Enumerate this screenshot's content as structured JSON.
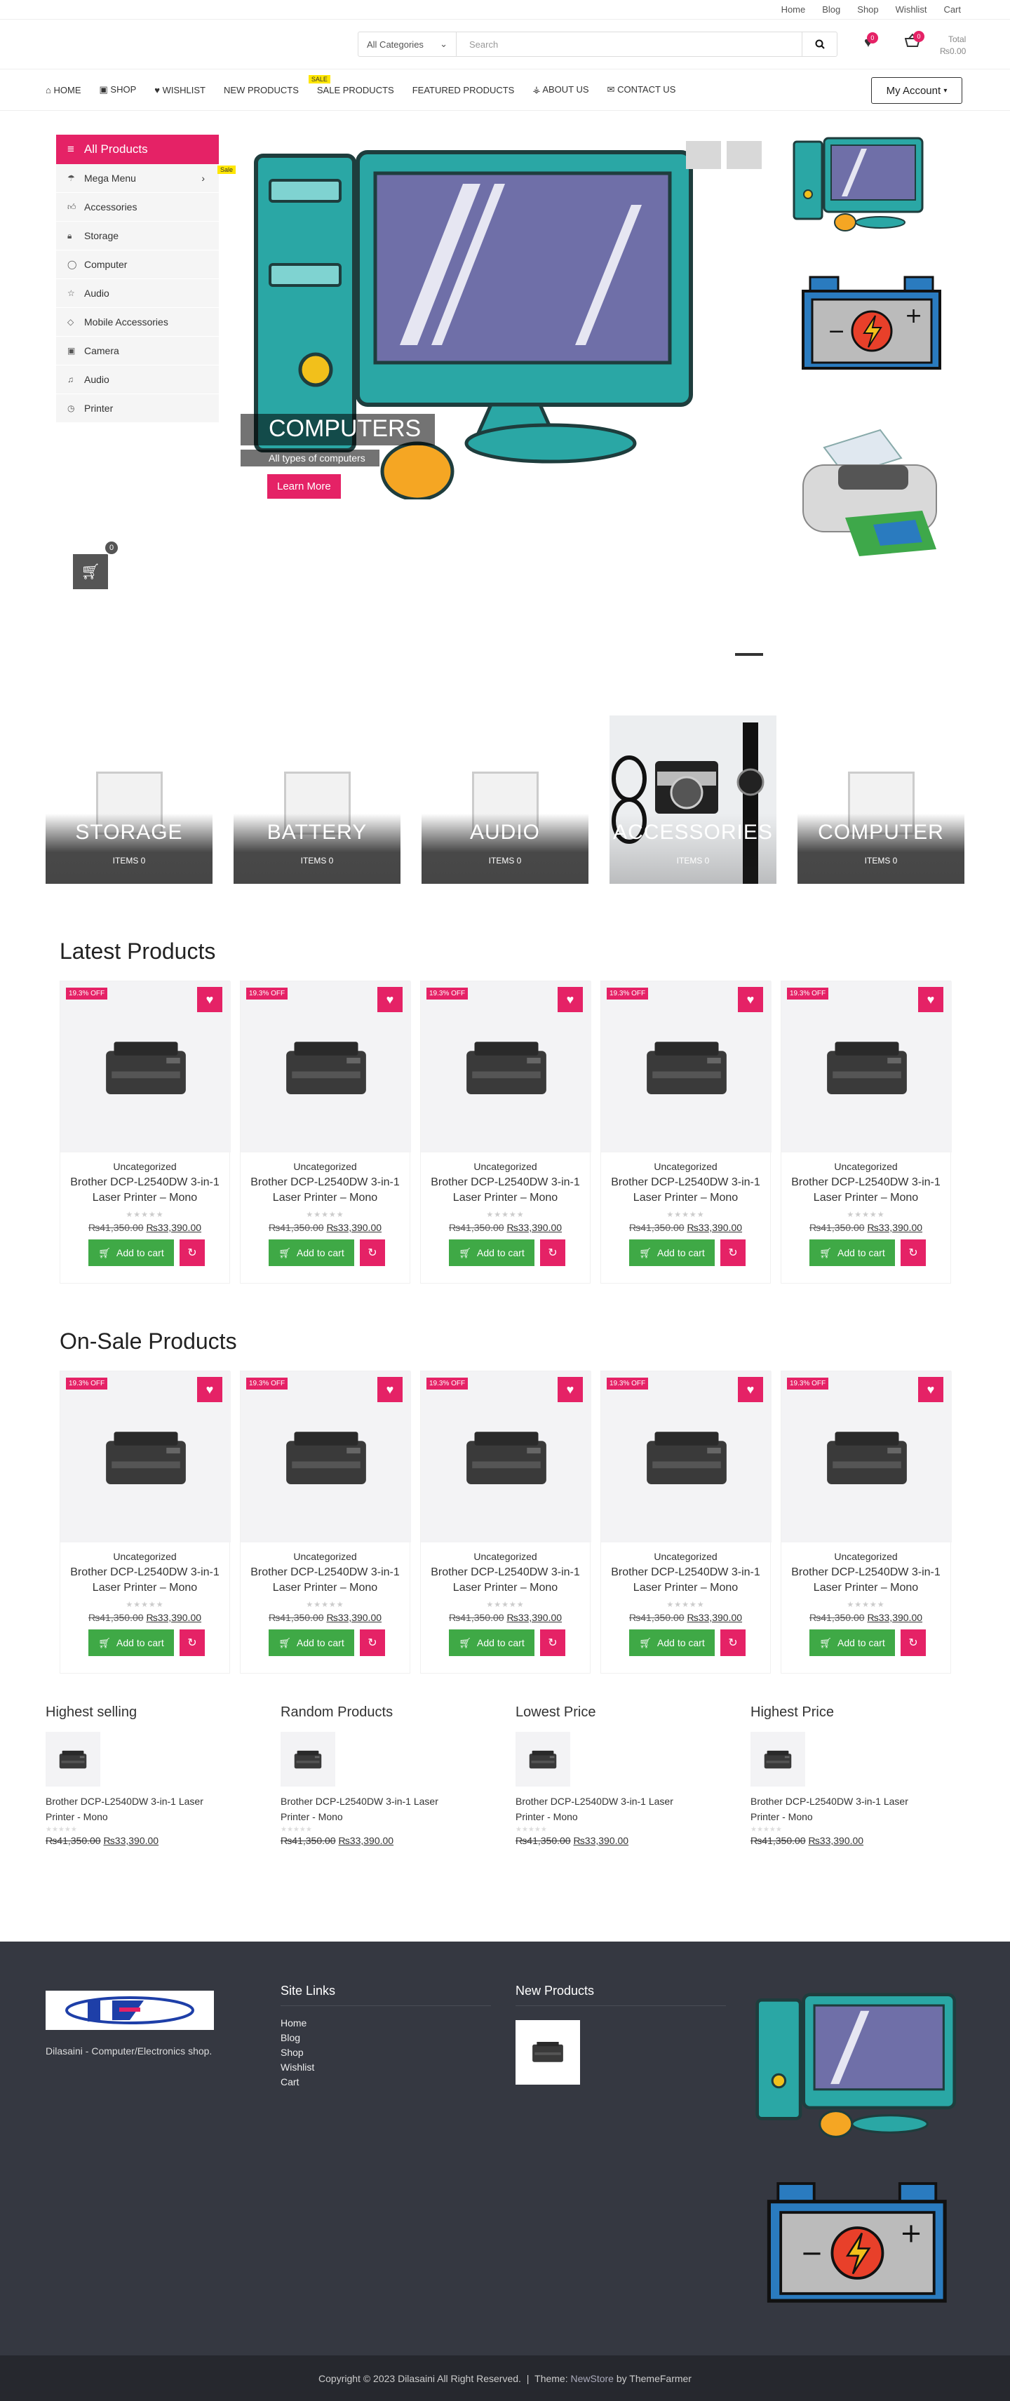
{
  "topbar": {
    "links": [
      "Home",
      "Blog",
      "Shop",
      "Wishlist",
      "Cart"
    ]
  },
  "header": {
    "search_category": "All Categories",
    "search_placeholder": "Search",
    "wishlist_count": "0",
    "cart_count": "0",
    "cart_total_label": "Total",
    "cart_total": "₨0.00"
  },
  "nav": {
    "items": [
      "HOME",
      "SHOP",
      "WISHLIST",
      "NEW PRODUCTS",
      "SALE PRODUCTS",
      "FEATURED PRODUCTS",
      "ABOUT US",
      "CONTACT US"
    ],
    "sale_badge": "SALE",
    "account": "My Account"
  },
  "sidebar": {
    "title": "All Products",
    "items": [
      "Mega Menu",
      "Accessories",
      "Storage",
      "Computer",
      "Audio",
      "Mobile Accessories",
      "Camera",
      "Audio",
      "Printer"
    ],
    "mega_badge": "Sale"
  },
  "hero": {
    "title": "COMPUTERS",
    "subtitle": "All types of computers",
    "button": "Learn More"
  },
  "float_cart": {
    "count": "0"
  },
  "categories": [
    {
      "name": "STORAGE",
      "count": "ITEMS 0"
    },
    {
      "name": "BATTERY",
      "count": "ITEMS 0"
    },
    {
      "name": "AUDIO",
      "count": "ITEMS 0"
    },
    {
      "name": "ACCESSORIES",
      "count": "ITEMS 0"
    },
    {
      "name": "COMPUTER",
      "count": "ITEMS 0"
    }
  ],
  "latest": {
    "title": "Latest Products"
  },
  "onsale": {
    "title": "On-Sale Products"
  },
  "product": {
    "tag": "19.3% OFF",
    "category": "Uncategorized",
    "name_line1": "Brother DCP-L2540DW 3-in-1",
    "name_line2": "Laser Printer – Mono",
    "old_price": "₨41,350.00",
    "new_price": "₨33,390.00",
    "add_to_cart": "Add to cart"
  },
  "widgets": [
    {
      "title": "Highest selling"
    },
    {
      "title": "Random Products"
    },
    {
      "title": "Lowest Price"
    },
    {
      "title": "Highest Price"
    }
  ],
  "widget_product": {
    "name": "Brother DCP-L2540DW 3-in-1 Laser Printer - Mono",
    "old_price": "₨41,350.00",
    "new_price": "₨33,390.00"
  },
  "footer": {
    "tagline": "Dilasaini - Computer/Electronics shop.",
    "site_links_title": "Site Links",
    "site_links": [
      "Home",
      "Blog",
      "Shop",
      "Wishlist",
      "Cart"
    ],
    "new_products_title": "New Products",
    "copyright": "Copyright © 2023 Dilasaini All Right Reserved.",
    "theme_label": "Theme:",
    "theme_name": "NewStore",
    "theme_by": "by ThemeFarmer"
  },
  "colors": {
    "accent": "#e52266",
    "green": "#3fa946",
    "footer": "#353841"
  }
}
